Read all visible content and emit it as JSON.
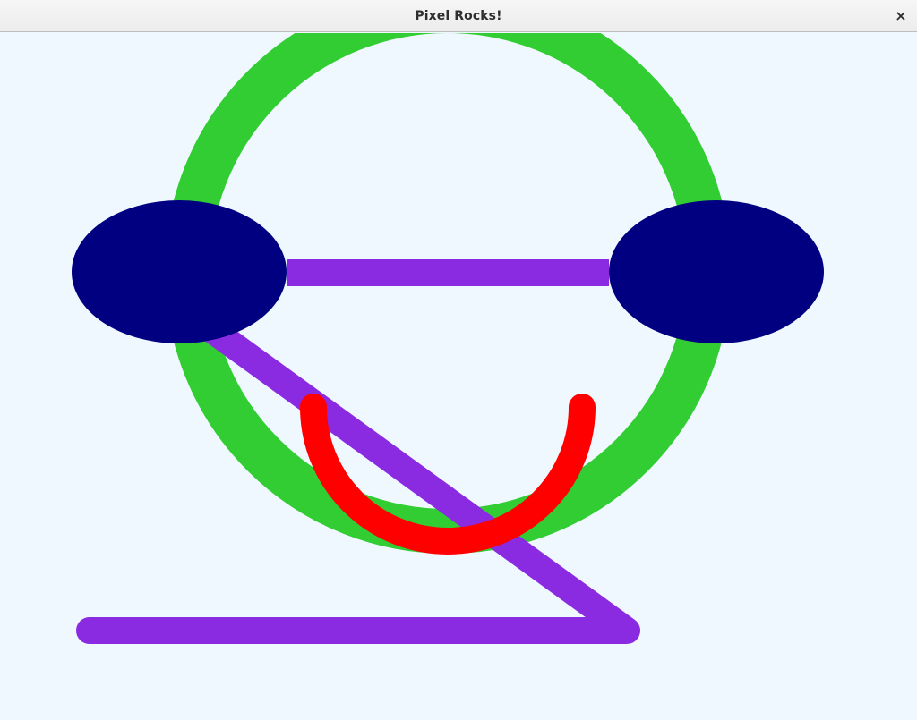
{
  "window": {
    "title": "Pixel Rocks!",
    "close_symbol": "×",
    "close_icon": "close-icon"
  },
  "canvas": {
    "background": "#f0f8ff",
    "colors": {
      "face_ring": "#32cd32",
      "eyes": "#000080",
      "lines": "#8a2be2",
      "smile": "#ff0000"
    }
  }
}
